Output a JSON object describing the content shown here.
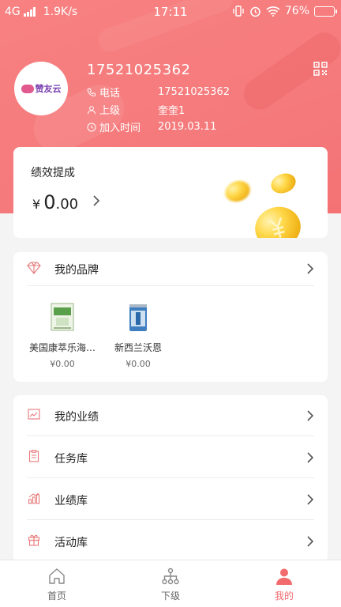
{
  "status_bar": {
    "network": "4G",
    "speed": "1.9K/s",
    "time": "17:11",
    "battery": "76%",
    "battery_level": 0.76
  },
  "profile": {
    "avatar_logo_text": "赞友云",
    "phone_heading": "17521025362",
    "fields": [
      {
        "label": "电话",
        "value": "17521025362",
        "icon": "phone-icon"
      },
      {
        "label": "上级",
        "value": "奎奎1",
        "icon": "person-icon"
      },
      {
        "label": "加入时间",
        "value": "2019.03.11",
        "icon": "clock-icon"
      }
    ]
  },
  "performance": {
    "title": "绩效提成",
    "currency": "¥",
    "amount_int": "0",
    "amount_dec": ".00"
  },
  "brands": {
    "title": "我的品牌",
    "products": [
      {
        "name": "美国康萃乐海…",
        "price": "¥0.00"
      },
      {
        "name": "新西兰沃恩",
        "price": "¥0.00"
      }
    ]
  },
  "menu": {
    "items": [
      {
        "label": "我的业绩",
        "icon": "chart-icon"
      },
      {
        "label": "任务库",
        "icon": "clipboard-icon"
      },
      {
        "label": "业绩库",
        "icon": "bar-chart-icon"
      },
      {
        "label": "活动库",
        "icon": "gift-icon"
      }
    ]
  },
  "tabbar": {
    "tabs": [
      {
        "label": "首页",
        "icon": "home-icon",
        "active": false
      },
      {
        "label": "下级",
        "icon": "hierarchy-icon",
        "active": false
      },
      {
        "label": "我的",
        "icon": "user-icon",
        "active": true
      }
    ]
  },
  "colors": {
    "header": "#f57a7c",
    "accent": "#f26b6d",
    "coin": "#ffd84a"
  }
}
